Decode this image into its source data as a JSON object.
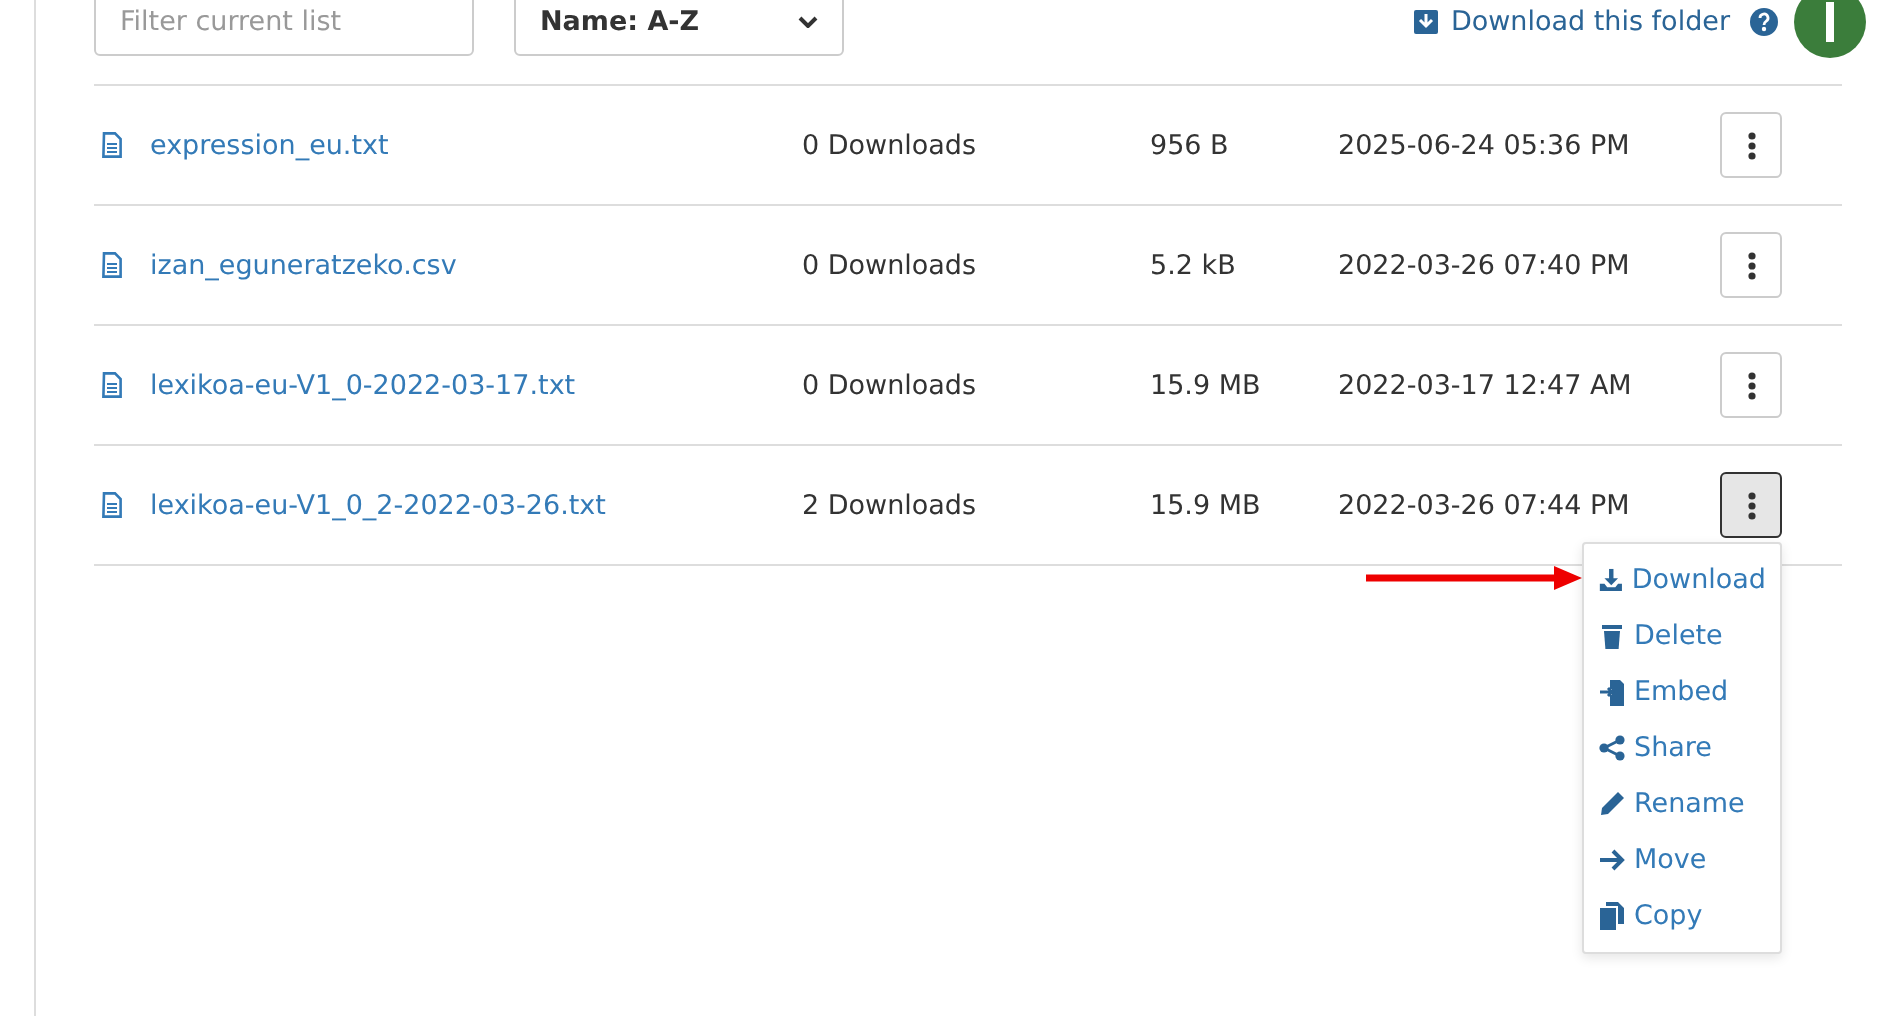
{
  "toolbar": {
    "filter": {
      "placeholder": "Filter current list"
    },
    "sort": {
      "value": "Name: A-Z"
    },
    "download_folder": "Download this folder"
  },
  "files": [
    {
      "name": "expression_eu.txt",
      "downloads": "0 Downloads",
      "size": "956 B",
      "date": "2025-06-24 05:36 PM",
      "menu_open": false
    },
    {
      "name": "izan_eguneratzeko.csv",
      "downloads": "0 Downloads",
      "size": "5.2 kB",
      "date": "2022-03-26 07:40 PM",
      "menu_open": false
    },
    {
      "name": "lexikoa-eu-V1_0-2022-03-17.txt",
      "downloads": "0 Downloads",
      "size": "15.9 MB",
      "date": "2022-03-17 12:47 AM",
      "menu_open": false
    },
    {
      "name": "lexikoa-eu-V1_0_2-2022-03-26.txt",
      "downloads": "2 Downloads",
      "size": "15.9 MB",
      "date": "2022-03-26 07:44 PM",
      "menu_open": true
    }
  ],
  "menu": [
    {
      "kind": "download",
      "label": "Download"
    },
    {
      "kind": "delete",
      "label": "Delete"
    },
    {
      "kind": "embed",
      "label": "Embed"
    },
    {
      "kind": "share",
      "label": "Share"
    },
    {
      "kind": "rename",
      "label": "Rename"
    },
    {
      "kind": "move",
      "label": "Move"
    },
    {
      "kind": "copy",
      "label": "Copy"
    }
  ]
}
